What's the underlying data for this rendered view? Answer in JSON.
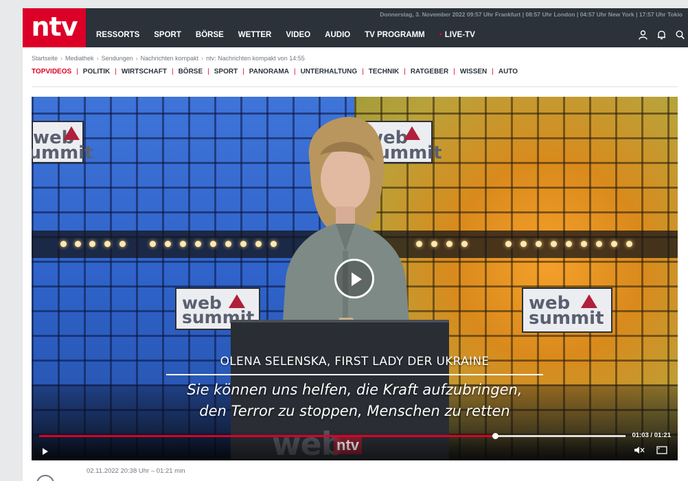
{
  "header": {
    "logo_text": "ntv",
    "datebar": "Donnerstag, 3. November 2022 09:57 Uhr Frankfurt | 08:57 Uhr London | 04:57 Uhr New York | 17:57 Uhr Tokio",
    "nav": [
      {
        "label": "RESSORTS"
      },
      {
        "label": "SPORT"
      },
      {
        "label": "BÖRSE"
      },
      {
        "label": "WETTER"
      },
      {
        "label": "VIDEO"
      },
      {
        "label": "AUDIO"
      },
      {
        "label": "TV PROGRAMM"
      },
      {
        "label": "LIVE-TV",
        "live": true
      }
    ],
    "icons": [
      "user-icon",
      "bell-icon",
      "search-icon"
    ]
  },
  "breadcrumb": [
    "Startseite",
    "Mediathek",
    "Sendungen",
    "Nachrichten kompakt",
    "ntv: Nachrichten kompakt von 14:55"
  ],
  "subnav": [
    {
      "label": "TOPVIDEOS",
      "active": true
    },
    {
      "label": "POLITIK"
    },
    {
      "label": "WIRTSCHAFT"
    },
    {
      "label": "BÖRSE"
    },
    {
      "label": "SPORT"
    },
    {
      "label": "PANORAMA"
    },
    {
      "label": "UNTERHALTUNG"
    },
    {
      "label": "TECHNIK"
    },
    {
      "label": "RATGEBER"
    },
    {
      "label": "WISSEN"
    },
    {
      "label": "AUTO"
    }
  ],
  "video": {
    "caption_name": "OLENA SELENSKA, FIRST LADY DER UKRAINE",
    "caption_line1": "Sie können uns helfen, die Kraft aufzubringen,",
    "caption_line2": "den Terror zu stoppen, Menschen zu retten",
    "sign_text_top": "web",
    "sign_text_bottom": "summit",
    "podium_logo": "web",
    "podium_logo_2": "summit",
    "podium_ntv": "ntv",
    "time_display": "01:03 / 01:21",
    "progress": 0.7778,
    "accent_color": "#dc0028"
  },
  "meta": {
    "date_duration": "02.11.2022 20:38 Uhr – 01:21 min"
  }
}
